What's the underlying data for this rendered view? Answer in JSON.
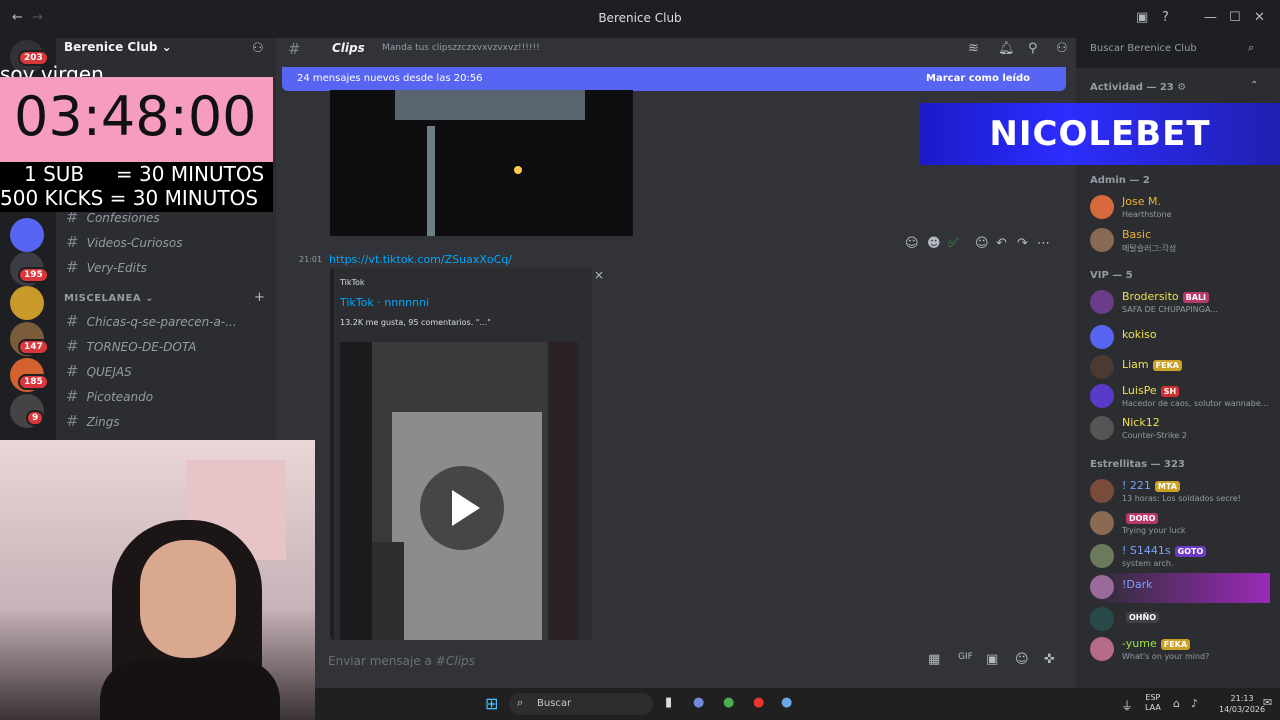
{
  "window": {
    "title": "Berenice Club"
  },
  "server": {
    "name": "Berenice Club",
    "rail_badges": [
      "203",
      "195",
      "147",
      "185",
      "9"
    ]
  },
  "channels": {
    "items_top": [
      {
        "name": "Confesiones"
      },
      {
        "name": "Videos-Curiosos"
      },
      {
        "name": "Very-Edits"
      }
    ],
    "category": "MISCELANEA",
    "items_misc": [
      {
        "name": "Chicas-q-se-parecen-a-..."
      },
      {
        "name": "TORNEO-DE-DOTA"
      },
      {
        "name": "QUEJAS"
      },
      {
        "name": "Picoteando"
      },
      {
        "name": "Zings"
      }
    ]
  },
  "header": {
    "channel": "Clips",
    "topic": "Manda tus clipszzczxvxvzvxvz!!!!!!",
    "search_placeholder": "Buscar Berenice Club"
  },
  "new_messages": {
    "text": "24 mensajes nuevos desde las 20:56",
    "mark_read": "Marcar como leído"
  },
  "message": {
    "time": "21:01",
    "link": "https://vt.tiktok.com/ZSuaxXoCq/",
    "embed_provider": "TikTok",
    "embed_title": "TikTok · nnnnnni",
    "embed_desc": "13.2K me gusta, 95 comentarios. \"...\"",
    "close": "×"
  },
  "composer": {
    "placeholder": "Enviar mensaje a #",
    "channel": "Clips"
  },
  "members": {
    "activity": "Actividad — 23",
    "admin_header": "Admin — 2",
    "admins": [
      {
        "name": "Jose M.",
        "status": "Hearthstone",
        "color": "#f0b232"
      },
      {
        "name": "Basic",
        "status": "메탈슬러그:각성",
        "color": "#f0b232"
      }
    ],
    "vip_header": "VIP — 5",
    "vips": [
      {
        "name": "Brodersito",
        "tag": "BALI",
        "status": "SAFA DE CHUPAPINGA...",
        "color": "#f0e050"
      },
      {
        "name": "kokiso",
        "tag": "",
        "status": "",
        "color": "#f0e050"
      },
      {
        "name": "Liam",
        "tag": "FEKA",
        "status": "",
        "color": "#f0e050"
      },
      {
        "name": "LuisPe",
        "tag": "SH",
        "status": "Hacedor de caos, solutor wannabe...",
        "color": "#f0e050"
      },
      {
        "name": "Nick12",
        "tag": "",
        "status": "Counter-Strike 2",
        "color": "#f0e050"
      }
    ],
    "estrellitas_header": "Estrellitas — 323",
    "estrellitas": [
      {
        "name": "! 221",
        "tag": "MTA",
        "status": "13 horas: Los soldados secre!",
        "color": "#7aa2ff"
      },
      {
        "name": "",
        "tag": "DORO",
        "status": "Trying your luck",
        "color": "#ff4040"
      },
      {
        "name": "! S1441s",
        "tag": "GOTO",
        "status": "system arch.",
        "color": "#7aa2ff"
      },
      {
        "name": "!Dark",
        "tag": "",
        "status": "",
        "color": "#7aa2ff"
      },
      {
        "name": "",
        "tag": "OHÑO",
        "status": "",
        "color": "#ff4040"
      },
      {
        "name": "-yume",
        "tag": "FEKA",
        "status": "What's on your mind?",
        "color": "#a0e040"
      }
    ]
  },
  "overlay": {
    "timer": "03:48:00",
    "top_text": "soy virgen",
    "line1": "1 SUB     = 30 MINUTOS",
    "line2": "500 KICKS = 30 MINUTOS",
    "sponsor": "NICOLEBET"
  },
  "taskbar": {
    "search": "Buscar",
    "lang": "ESP",
    "lang2": "LAA",
    "time": "21:13",
    "date": "14/03/2026"
  }
}
